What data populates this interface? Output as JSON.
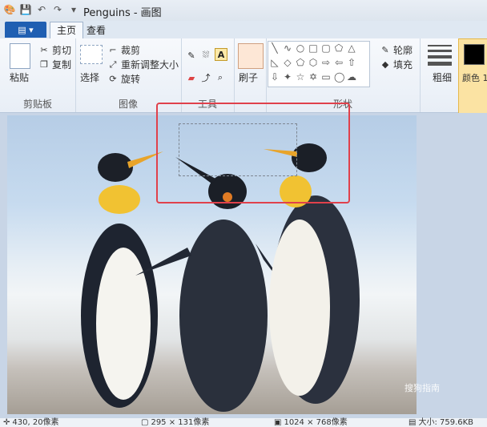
{
  "window": {
    "title": "Penguins - 画图"
  },
  "tabs": {
    "file": "",
    "home": "主页",
    "view": "查看"
  },
  "clipboard": {
    "paste": "粘贴",
    "cut": "剪切",
    "copy": "复制",
    "label": "剪贴板"
  },
  "image": {
    "select": "选择",
    "crop": "裁剪",
    "resize": "重新调整大小",
    "rotate": "旋转",
    "label": "图像"
  },
  "tools": {
    "label": "工具"
  },
  "brushes": {
    "label": "刷子"
  },
  "shapes": {
    "outline": "轮廓",
    "fill": "填充",
    "label": "形状"
  },
  "size": {
    "label": "粗细"
  },
  "colors": {
    "color1": "颜色 1"
  },
  "status": {
    "cursor": "430, 20像素",
    "selection": "295 × 131像素",
    "image_size": "1024 × 768像素",
    "file_size": "大小: 759.6KB"
  },
  "watermark": "搜狗指南",
  "colors_hex": {
    "accent": "#1f5fb2",
    "highlight": "#e0414b",
    "color1_swatch": "#000000"
  }
}
